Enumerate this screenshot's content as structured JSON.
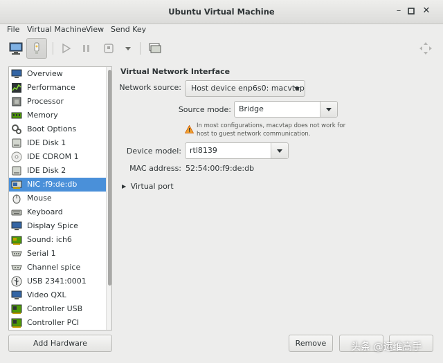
{
  "window": {
    "title": "Ubuntu Virtual Machine"
  },
  "menu": [
    "File",
    "Virtual Machine",
    "View",
    "Send Key"
  ],
  "sidebar": {
    "items": [
      {
        "label": "Overview",
        "icon": "monitor-icon"
      },
      {
        "label": "Performance",
        "icon": "performance-chart-icon"
      },
      {
        "label": "Processor",
        "icon": "chip-icon"
      },
      {
        "label": "Memory",
        "icon": "memory-module-icon"
      },
      {
        "label": "Boot Options",
        "icon": "gears-icon"
      },
      {
        "label": "IDE Disk 1",
        "icon": "disk-icon"
      },
      {
        "label": "IDE CDROM 1",
        "icon": "cdrom-icon"
      },
      {
        "label": "IDE Disk 2",
        "icon": "disk-icon"
      },
      {
        "label": "NIC :f9:de:db",
        "icon": "network-card-icon"
      },
      {
        "label": "Mouse",
        "icon": "mouse-icon"
      },
      {
        "label": "Keyboard",
        "icon": "keyboard-icon"
      },
      {
        "label": "Display Spice",
        "icon": "display-icon"
      },
      {
        "label": "Sound: ich6",
        "icon": "sound-card-icon"
      },
      {
        "label": "Serial 1",
        "icon": "serial-port-icon"
      },
      {
        "label": "Channel spice",
        "icon": "channel-icon"
      },
      {
        "label": "USB 2341:0001",
        "icon": "usb-icon"
      },
      {
        "label": "Video QXL",
        "icon": "video-card-icon"
      },
      {
        "label": "Controller USB",
        "icon": "controller-icon"
      },
      {
        "label": "Controller PCI",
        "icon": "controller-icon"
      }
    ],
    "selected_index": 8
  },
  "buttons": {
    "add_hardware": "Add Hardware",
    "remove": "Remove"
  },
  "details": {
    "section_title": "Virtual Network Interface",
    "network_source_label": "Network source:",
    "network_source_value": "Host device enp6s0: macvtap",
    "source_mode_label": "Source mode:",
    "source_mode_value": "Bridge",
    "warning": "In most configurations, macvtap does not work for host to guest network communication.",
    "device_model_label": "Device model:",
    "device_model_value": "rtl8139",
    "mac_label": "MAC address:",
    "mac_value": "52:54:00:f9:de:db",
    "virtual_port": "Virtual port"
  },
  "watermark": "头条 @运维高手",
  "colors": {
    "selection": "#4a90d9",
    "warning": "#f0a030"
  }
}
